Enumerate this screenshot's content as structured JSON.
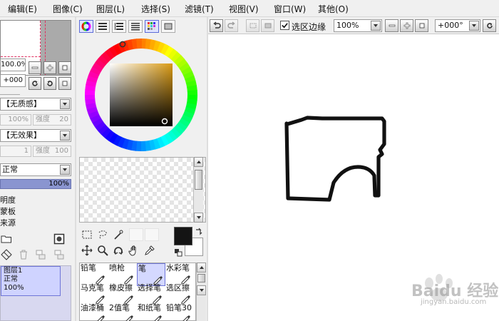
{
  "menu": [
    "编辑(E)",
    "图像(C)",
    "图层(L)",
    "选择(S)",
    "滤镜(T)",
    "视图(V)",
    "窗口(W)",
    "其他(O)"
  ],
  "navigator": {
    "zoom_value": "100.0%",
    "rotation_value": "+000"
  },
  "brush_settings": {
    "texture_select": "【无质感】",
    "texture_scale": "100%",
    "texture_strength_label": "强度",
    "texture_strength": "20",
    "effect_select": "【无效果】",
    "effect_width": "1",
    "effect_strength_label": "强度",
    "effect_strength": "100"
  },
  "layer_settings": {
    "blend_mode": "正常",
    "opacity": "100%",
    "opacity_level": 1.0,
    "option_protect": "明度",
    "option_clip": "蒙板",
    "option_source": "来源"
  },
  "layer_list": {
    "name": "图层1",
    "mode": "正常",
    "opacity": "100%"
  },
  "tools": {
    "row1": [
      "铅笔",
      "喷枪",
      "笔",
      "水彩笔"
    ],
    "row2": [
      "马克笔",
      "橡皮擦",
      "选择笔",
      "选区擦"
    ],
    "row3": [
      "油漆桶",
      "2值笔",
      "和纸笔",
      "铅笔30"
    ],
    "selected": "笔"
  },
  "colors": {
    "primary": "#141414",
    "secondary": "#ffffff",
    "accent": "#5c6bd8",
    "stroke": "#111111"
  },
  "toolbar": {
    "show_selection_label": "选区边缘",
    "show_selection_checked": true,
    "zoom": "100%",
    "rotation": "+000°"
  },
  "watermark": {
    "text": "Baidu 经验",
    "url": "jingyan.baidu.com"
  }
}
